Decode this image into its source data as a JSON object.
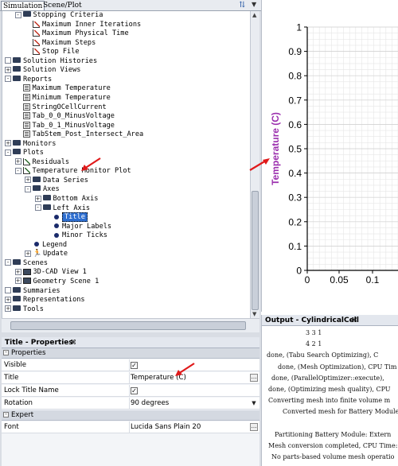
{
  "tabs": {
    "simulation": "Simulation",
    "scene_plot": "Scene/Plot"
  },
  "tree": [
    {
      "label": "Stopping Criteria",
      "icon": "folder-icon",
      "level": 1,
      "expander": "-"
    },
    {
      "label": "Maximum Inner Iterations",
      "icon": "criterion-icon",
      "level": 2
    },
    {
      "label": "Maximum Physical Time",
      "icon": "criterion-icon",
      "level": 2
    },
    {
      "label": "Maximum Steps",
      "icon": "criterion-icon",
      "level": 2
    },
    {
      "label": "Stop File",
      "icon": "criterion-icon",
      "level": 2
    },
    {
      "label": "Solution Histories",
      "icon": "folder-icon",
      "level": 0,
      "expander": ""
    },
    {
      "label": "Solution Views",
      "icon": "folder-icon",
      "level": 0,
      "expander": "+"
    },
    {
      "label": "Reports",
      "icon": "folder-icon",
      "level": 0,
      "expander": "-"
    },
    {
      "label": "Maximum Temperature",
      "icon": "report-icon",
      "level": 1
    },
    {
      "label": "Minimum Temperature",
      "icon": "report-icon",
      "level": 1
    },
    {
      "label": "StringOCellCurrent",
      "icon": "report-icon",
      "level": 1
    },
    {
      "label": "Tab_0_0_MinusVoltage",
      "icon": "report-icon",
      "level": 1
    },
    {
      "label": "Tab_0_1_MinusVoltage",
      "icon": "report-icon",
      "level": 1
    },
    {
      "label": "TabStem_Post_Intersect_Area",
      "icon": "report-icon",
      "level": 1
    },
    {
      "label": "Monitors",
      "icon": "folder-icon",
      "level": 0,
      "expander": "+"
    },
    {
      "label": "Plots",
      "icon": "folder-icon",
      "level": 0,
      "expander": "-"
    },
    {
      "label": "Residuals",
      "icon": "plot-icon",
      "level": 1,
      "expander": "+"
    },
    {
      "label": "Temperature Monitor Plot",
      "icon": "plot-icon",
      "level": 1,
      "expander": "-"
    },
    {
      "label": "Data Series",
      "icon": "folder-icon",
      "level": 2,
      "expander": "+"
    },
    {
      "label": "Axes",
      "icon": "folder-icon",
      "level": 2,
      "expander": "-"
    },
    {
      "label": "Bottom Axis",
      "icon": "folder-icon",
      "level": 3,
      "expander": "+"
    },
    {
      "label": "Left Axis",
      "icon": "folder-icon",
      "level": 3,
      "expander": "-"
    },
    {
      "label": "Title",
      "icon": "dot-icon",
      "level": 4,
      "selected": true
    },
    {
      "label": "Major Labels",
      "icon": "dot-icon",
      "level": 4
    },
    {
      "label": "Minor Ticks",
      "icon": "dot-icon",
      "level": 4
    },
    {
      "label": "Legend",
      "icon": "dot-icon",
      "level": 2
    },
    {
      "label": "Update",
      "icon": "run-icon",
      "level": 2,
      "expander": "+"
    },
    {
      "label": "Scenes",
      "icon": "folder-icon",
      "level": 0,
      "expander": "-"
    },
    {
      "label": "3D-CAD View 1",
      "icon": "scene-icon",
      "level": 1,
      "expander": "+"
    },
    {
      "label": "Geometry Scene 1",
      "icon": "scene-icon",
      "level": 1,
      "expander": "+"
    },
    {
      "label": "Summaries",
      "icon": "folder-icon",
      "level": 0,
      "expander": ""
    },
    {
      "label": "Representations",
      "icon": "folder-icon",
      "level": 0,
      "expander": "+"
    },
    {
      "label": "Tools",
      "icon": "folder-icon",
      "level": 0,
      "expander": "+"
    }
  ],
  "properties": {
    "title": "Title - Properties",
    "close": "⌘",
    "group_properties": "Properties",
    "group_expert": "Expert",
    "rows": [
      {
        "name": "Visible",
        "type": "checkbox",
        "checked": true
      },
      {
        "name": "Title",
        "type": "text",
        "value": "Temperature (C)"
      },
      {
        "name": "Lock Title Name",
        "type": "checkbox",
        "checked": true
      },
      {
        "name": "Rotation",
        "type": "dropdown",
        "value": "90 degrees"
      }
    ],
    "expert_rows": [
      {
        "name": "Font",
        "type": "text",
        "value": "Lucida Sans Plain 20"
      }
    ]
  },
  "chart_data": {
    "type": "line",
    "ylabel": "Temperature (C)",
    "xlabel": "",
    "ylim": [
      0,
      1
    ],
    "xlim": [
      0,
      0.15
    ],
    "y_ticks": [
      "0",
      "0.1",
      "0.2",
      "0.3",
      "0.4",
      "0.5",
      "0.6",
      "0.7",
      "0.8",
      "0.9",
      "1"
    ],
    "x_ticks": [
      "0",
      "0.05",
      "0.1",
      "0."
    ],
    "grid": true,
    "series": [],
    "accent_color": "#9b2fae"
  },
  "output": {
    "title": "Output - CylindricalCell",
    "close": "⌘",
    "lines": [
      "3              3           1",
      "4              2           1",
      "done, (Tabu Search Optimizing), C",
      "done, (Mesh Optimization), CPU Tim",
      "done, (ParallelOptimizer::execute),",
      "done, (Optimizing mesh quality), CPU",
      "Converting mesh into finite volume m",
      "Converted mesh for Battery Module",
      "",
      "Partitioning Battery Module: Extern",
      "Mesh conversion completed, CPU Time:",
      "No parts-based volume mesh operatio"
    ]
  }
}
